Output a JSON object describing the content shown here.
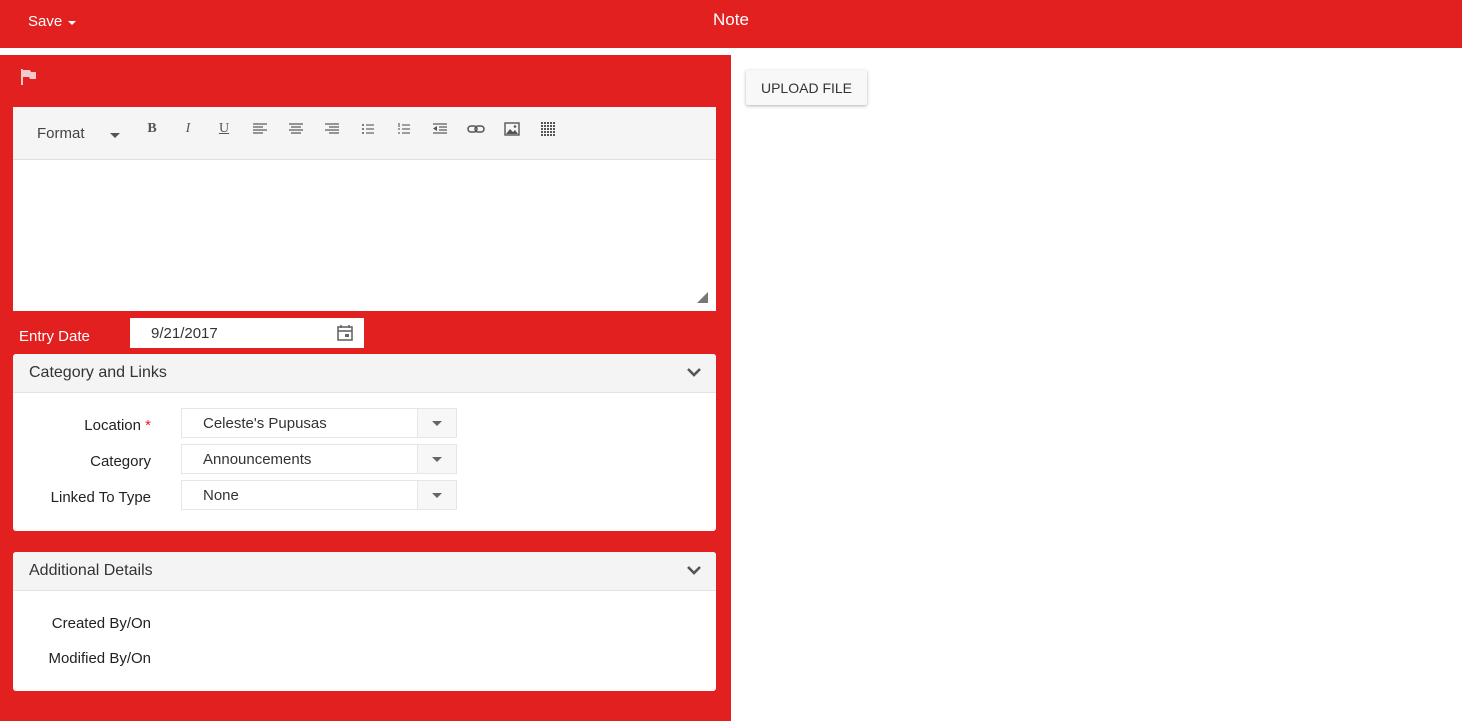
{
  "header": {
    "save_label": "Save",
    "title": "Note",
    "background_color": "#e32020"
  },
  "editor": {
    "format_label": "Format",
    "toolbar_icons": [
      "bold-icon",
      "italic-icon",
      "underline-icon",
      "align-left-icon",
      "align-center-icon",
      "align-right-icon",
      "bulleted-list-icon",
      "numbered-list-icon",
      "outdent-icon",
      "link-icon",
      "image-icon",
      "table-icon"
    ],
    "bold_glyph": "B",
    "italic_glyph": "I",
    "underline_glyph": "U"
  },
  "entry_date": {
    "label": "Entry Date",
    "value": "9/21/2017"
  },
  "category_section": {
    "title": "Category and Links",
    "location_label": "Location",
    "required_marker": "*",
    "location_value": "Celeste's Pupusas",
    "category_label": "Category",
    "category_value": "Announcements",
    "linked_label": "Linked To Type",
    "linked_value": "None"
  },
  "additional_section": {
    "title": "Additional Details",
    "created_label": "Created By/On",
    "modified_label": "Modified By/On"
  },
  "upload": {
    "label": "UPLOAD FILE"
  }
}
